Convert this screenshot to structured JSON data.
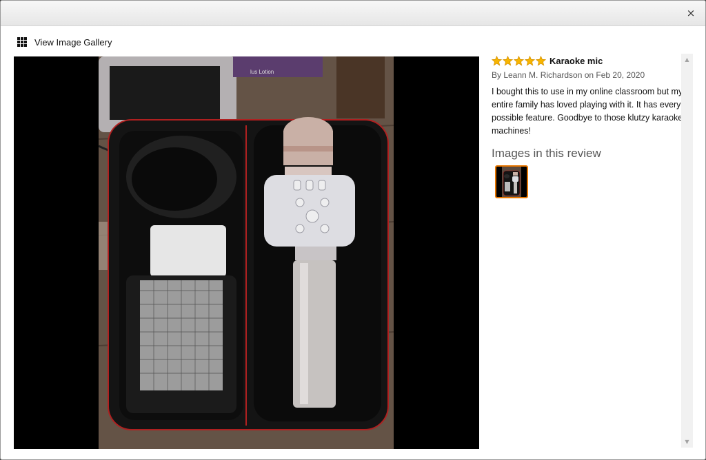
{
  "header": {
    "close_label": "×"
  },
  "gallery_link": {
    "label": "View Image Gallery",
    "icon": "grid-icon"
  },
  "review": {
    "rating": 5,
    "rating_max": 5,
    "title": "Karaoke mic",
    "byline": "By Leann M. Richardson on Feb 20, 2020",
    "body": "I bought this to use in my online classroom but my entire family has loved playing with it. It has every possible feature. Goodbye to those klutzy karaoke machines!",
    "images_heading": "Images in this review"
  },
  "colors": {
    "star": "#f7b500",
    "star_outline": "#d49000",
    "thumb_border": "#e77600"
  },
  "scrollbar": {
    "up_icon": "▲",
    "down_icon": "▼"
  }
}
